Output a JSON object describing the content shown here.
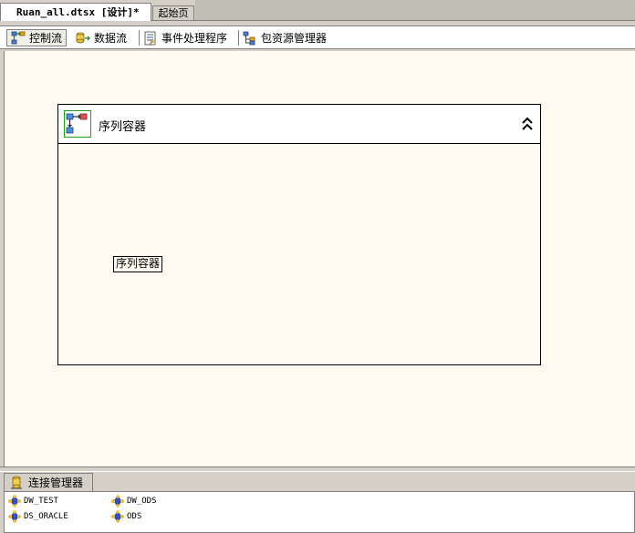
{
  "document_tabs": [
    {
      "label": "Ruan_all.dtsx [设计]*",
      "active": true
    },
    {
      "label": "起始页",
      "active": false
    }
  ],
  "designer_tabs": [
    {
      "label": "控制流",
      "icon": "control-flow-icon",
      "active": true
    },
    {
      "label": "数据流",
      "icon": "data-flow-icon",
      "active": false
    },
    {
      "label": "事件处理程序",
      "icon": "event-handler-icon",
      "active": false
    },
    {
      "label": "包资源管理器",
      "icon": "package-explorer-icon",
      "active": false
    }
  ],
  "canvas": {
    "background": "#fffbf0",
    "container": {
      "title": "序列容器",
      "icon": "sequence-container-icon",
      "collapse_icon": "double-chevron-up-icon",
      "inner_label": "序列容器"
    }
  },
  "connection_managers": {
    "tab_label": "连接管理器",
    "tab_icon": "connection-manager-icon",
    "items": [
      {
        "name": "DW_TEST",
        "icon": "connection-icon"
      },
      {
        "name": "DS_ORACLE",
        "icon": "connection-icon"
      },
      {
        "name": "DW_ODS",
        "icon": "connection-icon"
      },
      {
        "name": "ODS",
        "icon": "connection-icon"
      }
    ]
  }
}
